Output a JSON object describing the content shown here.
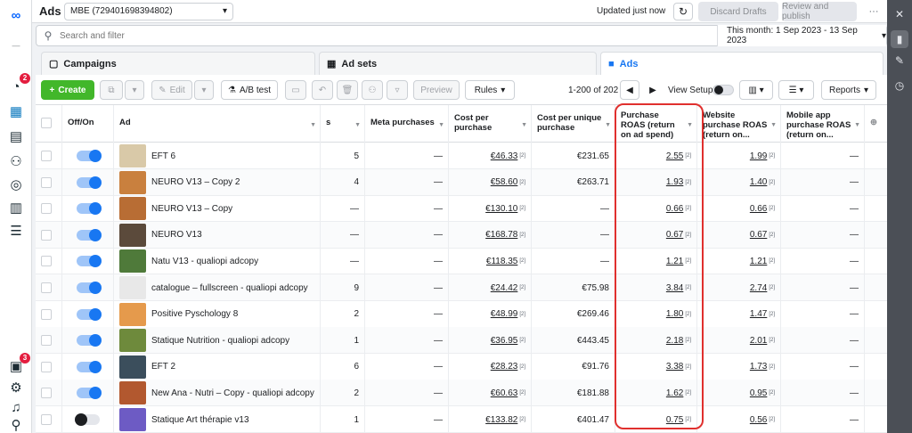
{
  "topbar": {
    "title": "Ads",
    "account": "MBE (729401698394802)",
    "updated": "Updated just now",
    "discard": "Discard Drafts",
    "review": "Review and publish"
  },
  "search": {
    "placeholder": "Search and filter",
    "daterange": "This month: 1 Sep 2023 - 13 Sep 2023"
  },
  "tabs": [
    {
      "label": "Campaigns"
    },
    {
      "label": "Ad sets"
    },
    {
      "label": "Ads"
    }
  ],
  "toolbar": {
    "create": "Create",
    "edit": "Edit",
    "abtest": "A/B test",
    "preview": "Preview",
    "rules": "Rules",
    "range": "1-200 of 202",
    "view_setup": "View Setup",
    "reports": "Reports"
  },
  "nav": {
    "notif_badge": "2",
    "alert_badge": "3"
  },
  "columns": {
    "onoff": "Off/On",
    "ad": "Ad",
    "s_frag": "s",
    "meta_purchases": "Meta purchases",
    "cost_per_purchase": "Cost per purchase",
    "cost_per_unique": "Cost per unique purchase",
    "purchase_roas": "Purchase ROAS (return on ad spend)",
    "website_roas": "Website purchase ROAS (return on...",
    "mobile_roas": "Mobile app purchase ROAS (return on..."
  },
  "rows": [
    {
      "on": true,
      "name": "EFT 6",
      "col_s": "5",
      "meta": "—",
      "cpp": "€46.33",
      "cpu": "€231.65",
      "roas": "2.55",
      "web": "1.99",
      "mob": "—",
      "thumb": "#d9c9a8"
    },
    {
      "on": true,
      "name": "NEURO V13 – Copy 2",
      "col_s": "4",
      "meta": "—",
      "cpp": "€58.60",
      "cpu": "€263.71",
      "roas": "1.93",
      "web": "1.40",
      "mob": "—",
      "thumb": "#c9803e"
    },
    {
      "on": true,
      "name": "NEURO V13 – Copy",
      "col_s": "—",
      "meta": "—",
      "cpp": "€130.10",
      "cpu": "—",
      "roas": "0.66",
      "web": "0.66",
      "mob": "—",
      "thumb": "#b86d34"
    },
    {
      "on": true,
      "name": "NEURO V13",
      "col_s": "—",
      "meta": "—",
      "cpp": "€168.78",
      "cpu": "—",
      "roas": "0.67",
      "web": "0.67",
      "mob": "—",
      "thumb": "#5b4a3b"
    },
    {
      "on": true,
      "name": "Natu V13 - qualiopi adcopy",
      "col_s": "—",
      "meta": "—",
      "cpp": "€118.35",
      "cpu": "—",
      "roas": "1.21",
      "web": "1.21",
      "mob": "—",
      "thumb": "#4f7a3a"
    },
    {
      "on": true,
      "name": "catalogue – fullscreen - qualiopi adcopy",
      "col_s": "9",
      "meta": "—",
      "cpp": "€24.42",
      "cpu": "€75.98",
      "roas": "3.84",
      "web": "2.74",
      "mob": "—",
      "thumb": "#e8e8e8"
    },
    {
      "on": true,
      "name": "Positive Pyschology 8",
      "col_s": "2",
      "meta": "—",
      "cpp": "€48.99",
      "cpu": "€269.46",
      "roas": "1.80",
      "web": "1.47",
      "mob": "—",
      "thumb": "#e59a4c"
    },
    {
      "on": true,
      "name": "Statique Nutrition - qualiopi adcopy",
      "col_s": "1",
      "meta": "—",
      "cpp": "€36.95",
      "cpu": "€443.45",
      "roas": "2.18",
      "web": "2.01",
      "mob": "—",
      "thumb": "#6e8a3c"
    },
    {
      "on": true,
      "name": "EFT 2",
      "col_s": "6",
      "meta": "—",
      "cpp": "€28.23",
      "cpu": "€91.76",
      "roas": "3.38",
      "web": "1.73",
      "mob": "—",
      "thumb": "#3b4e5c"
    },
    {
      "on": true,
      "name": "New Ana - Nutri – Copy - qualiopi adcopy",
      "col_s": "2",
      "meta": "—",
      "cpp": "€60.63",
      "cpu": "€181.88",
      "roas": "1.62",
      "web": "0.95",
      "mob": "—",
      "thumb": "#b2582f"
    },
    {
      "on": false,
      "name": "Statique Art thérapie v13",
      "col_s": "1",
      "meta": "—",
      "cpp": "€133.82",
      "cpu": "€401.47",
      "roas": "0.75",
      "web": "0.56",
      "mob": "—",
      "thumb": "#6d5bc4"
    }
  ],
  "colors": {
    "brand_blue": "#1877f2",
    "create_green": "#42b72a",
    "highlight_red": "#e0302e",
    "badge_red": "#e41e3f"
  }
}
